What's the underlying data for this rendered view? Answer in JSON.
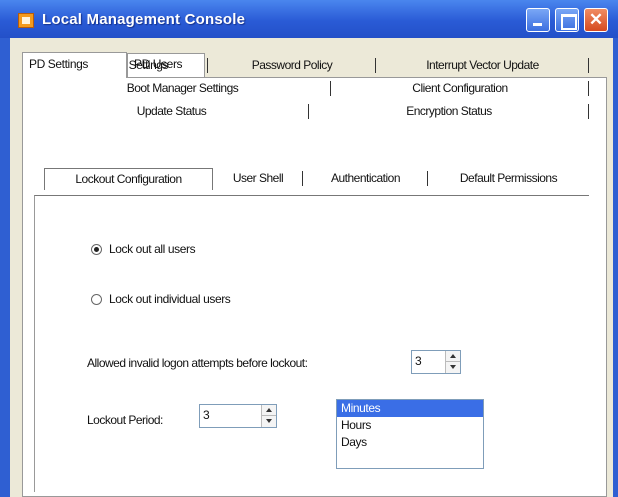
{
  "window": {
    "title": "Local Management Console"
  },
  "outer_tabs": [
    {
      "label": "PD Settings",
      "active": true
    },
    {
      "label": "PD Users",
      "active": false
    }
  ],
  "inner_tabs": {
    "row1": [
      "Encryption Settings",
      "Password Policy",
      "Interrupt Vector Update"
    ],
    "row2": [
      "Boot Manager Settings",
      "Client Configuration"
    ],
    "row3": [
      "Update Status",
      "Encryption Status"
    ],
    "row4": [
      "Lockout Configuration",
      "User Shell",
      "Authentication",
      "Default Permissions"
    ],
    "active": "Lockout Configuration"
  },
  "lockout": {
    "options": [
      {
        "label": "Lock out all users",
        "checked": true
      },
      {
        "label": "Lock out individual users",
        "checked": false
      }
    ],
    "attempts_label": "Allowed invalid logon attempts before lockout:",
    "attempts_value": "3",
    "period_label": "Lockout Period:",
    "period_value": "3",
    "period_units": [
      "Minutes",
      "Hours",
      "Days"
    ],
    "selected_unit": "Minutes"
  },
  "colors": {
    "titlebar": "#2a5bd6",
    "background": "#e48f1e",
    "selection": "#3a6ee6"
  }
}
